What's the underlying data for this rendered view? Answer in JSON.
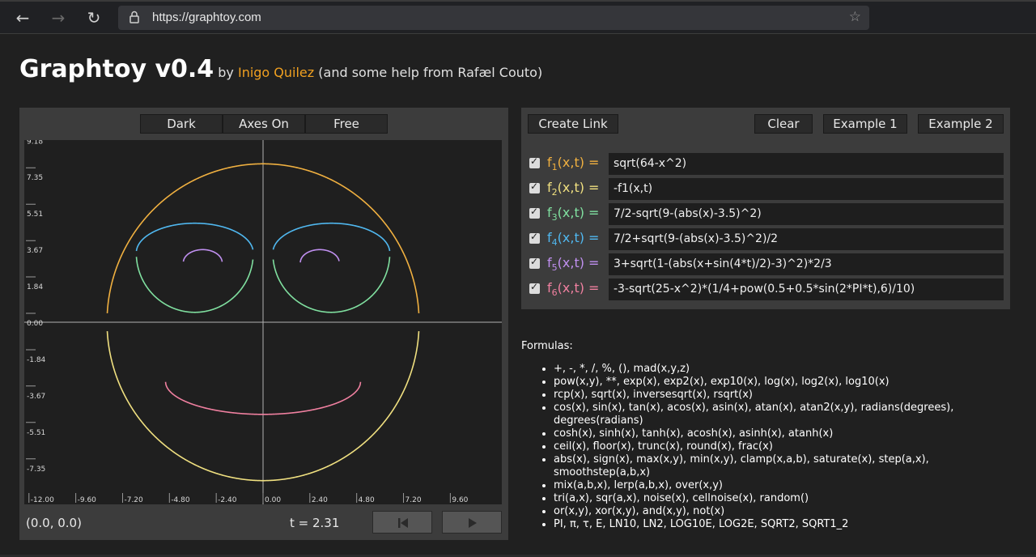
{
  "browser": {
    "url": "https://graphtoy.com"
  },
  "header": {
    "title": "Graphtoy v0.4",
    "by": "by",
    "author": "Inigo Quilez",
    "credit": "(and some help from Rafæl Couto)"
  },
  "graph_controls": {
    "theme": "Dark",
    "axes": "Axes On",
    "mode": "Free"
  },
  "graph": {
    "y_ticks": [
      "9.18",
      "7.35",
      "5.51",
      "3.67",
      "1.84",
      "0.00",
      "-1.84",
      "-3.67",
      "-5.51",
      "-7.35"
    ],
    "x_ticks": [
      "-12.00",
      "-9.60",
      "-7.20",
      "-4.80",
      "-2.40",
      "0.00",
      "2.40",
      "4.80",
      "7.20",
      "9.60"
    ],
    "coord_readout": "(0.0, 0.0)",
    "time_readout": "t = 2.31"
  },
  "formula_toolbar": {
    "create_link": "Create Link",
    "clear": "Clear",
    "example1": "Example 1",
    "example2": "Example 2"
  },
  "functions": [
    {
      "name": "f",
      "sub": "1",
      "args": "(x,t) =",
      "expr": "sqrt(64-x^2)",
      "color": "#f0b040",
      "checked": true
    },
    {
      "name": "f",
      "sub": "2",
      "args": "(x,t) =",
      "expr": "-f1(x,t)",
      "color": "#f0e080",
      "checked": true
    },
    {
      "name": "f",
      "sub": "3",
      "args": "(x,t) =",
      "expr": "7/2-sqrt(9-(abs(x)-3.5)^2)",
      "color": "#80e0a0",
      "checked": true
    },
    {
      "name": "f",
      "sub": "4",
      "args": "(x,t) =",
      "expr": "7/2+sqrt(9-(abs(x)-3.5)^2)/2",
      "color": "#50b8f0",
      "checked": true
    },
    {
      "name": "f",
      "sub": "5",
      "args": "(x,t) =",
      "expr": "3+sqrt(1-(abs(x+sin(4*t)/2)-3)^2)*2/3",
      "color": "#c090f0",
      "checked": true
    },
    {
      "name": "f",
      "sub": "6",
      "args": "(x,t) =",
      "expr": "-3-sqrt(25-x^2)*(1/4+pow(0.5+0.5*sin(2*PI*t),6)/10)",
      "color": "#f080a0",
      "checked": true
    }
  ],
  "help": {
    "title": "Formulas:",
    "items": [
      "+, -, *, /, %, (), mad(x,y,z)",
      "pow(x,y), **, exp(x), exp2(x), exp10(x), log(x), log2(x), log10(x)",
      "rcp(x), sqrt(x), inversesqrt(x), rsqrt(x)",
      "cos(x), sin(x), tan(x), acos(x), asin(x), atan(x), atan2(x,y), radians(degrees), degrees(radians)",
      "cosh(x), sinh(x), tanh(x), acosh(x), asinh(x), atanh(x)",
      "ceil(x), floor(x), trunc(x), round(x), frac(x)",
      "abs(x), sign(x), max(x,y), min(x,y), clamp(x,a,b), saturate(x), step(a,x), smoothstep(a,b,x)",
      "mix(a,b,x), lerp(a,b,x), over(x,y)",
      "tri(a,x), sqr(a,x), noise(x), cellnoise(x), random()",
      "or(x,y), xor(x,y), and(x,y), not(x)",
      "PI, π, τ, E, LN10, LN2, LOG10E, LOG2E, SQRT2, SQRT1_2"
    ]
  }
}
